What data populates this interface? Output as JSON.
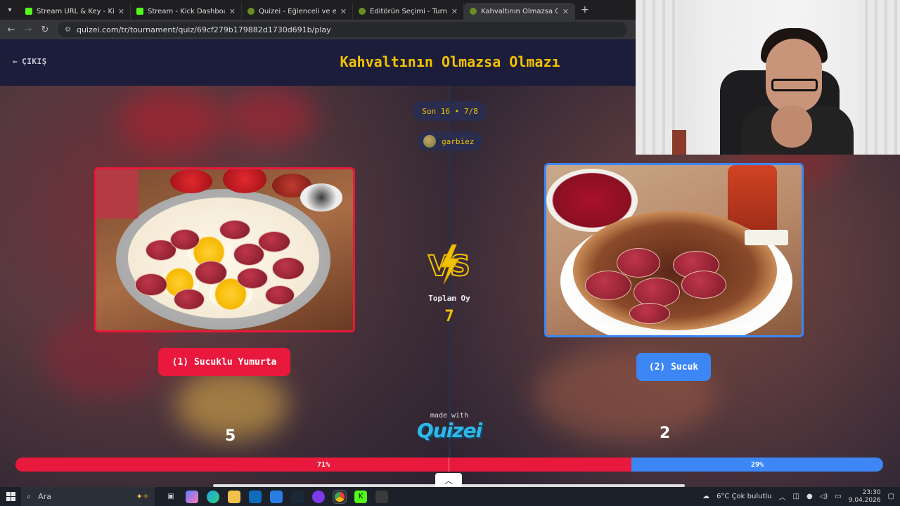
{
  "browser": {
    "tabs": [
      {
        "label": "Stream URL & Key - Kick Dashb",
        "fav": "kick"
      },
      {
        "label": "Stream - Kick Dashboard",
        "fav": "kick"
      },
      {
        "label": "Quizei - Eğlenceli ve etkileşiml",
        "fav": "quiz"
      },
      {
        "label": "Editörün Seçimi - Turnuva - Qu",
        "fav": "quiz"
      },
      {
        "label": "Kahvaltının Olmazsa Olmazı - T",
        "fav": "quiz",
        "active": true
      }
    ],
    "url": "quizei.com/tr/tournament/quiz/69cf279b179882d1730d691b/play"
  },
  "quiz": {
    "exit_label": "ÇIKIŞ",
    "title": "Kahvaltının Olmazsa Olmazı",
    "round": "Son 16 • 7/8",
    "username": "garbiez",
    "total_label": "Toplam Oy",
    "total_votes": "7",
    "made_with": "made with",
    "brand": "Quizei",
    "left": {
      "label": "(1) Sucuklu Yumurta",
      "votes": "5",
      "percent": "71%",
      "share": 0.71
    },
    "right": {
      "label": "(2) Sucuk",
      "votes": "2",
      "percent": "29%",
      "share": 0.29
    },
    "colors": {
      "left": "#e8193c",
      "right": "#3d86f5",
      "accent": "#f2c200"
    }
  },
  "taskbar": {
    "search_placeholder": "Ara",
    "weather": "6°C  Çok bulutlu",
    "time": "23:30",
    "date": "9.04.2026"
  }
}
